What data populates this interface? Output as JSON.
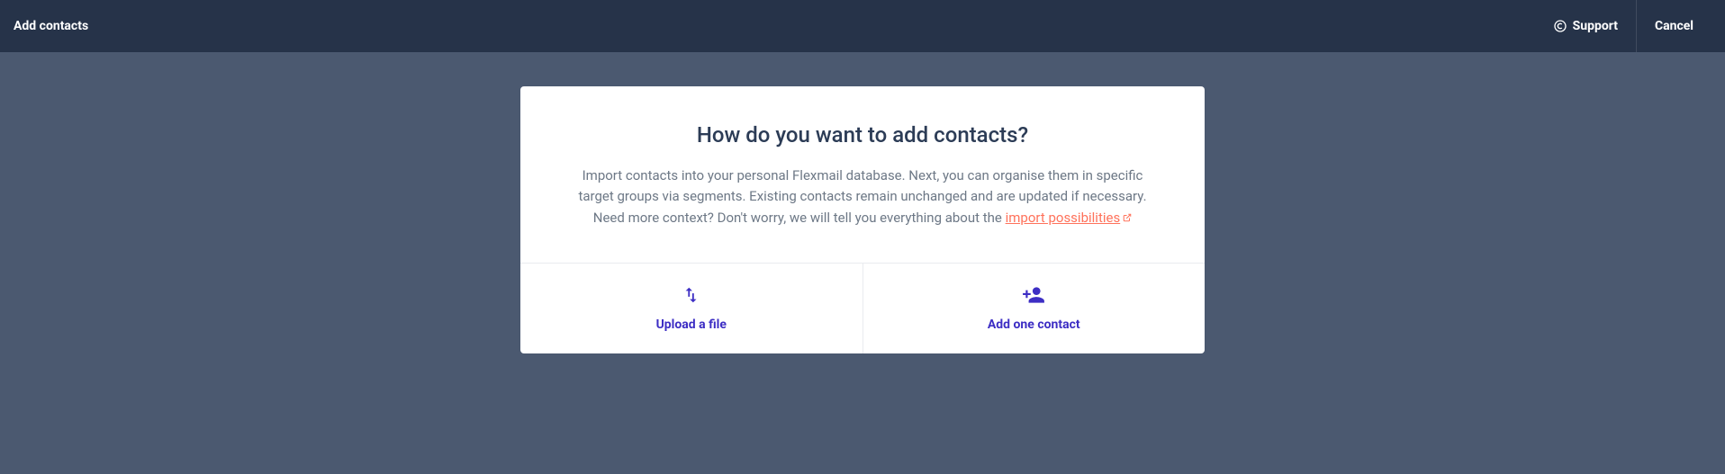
{
  "header": {
    "title": "Add contacts",
    "support_label": "Support",
    "cancel_label": "Cancel"
  },
  "card": {
    "heading": "How do you want to add contacts?",
    "description_prefix": "Import contacts into your personal Flexmail database. Next, you can organise them in specific target groups via segments. Existing contacts remain unchanged and are updated if necessary. Need more context? Don't worry, we will tell you everything about the ",
    "link_text": "import possibilities"
  },
  "options": {
    "upload": {
      "label": "Upload a file"
    },
    "add_one": {
      "label": "Add one contact"
    }
  }
}
